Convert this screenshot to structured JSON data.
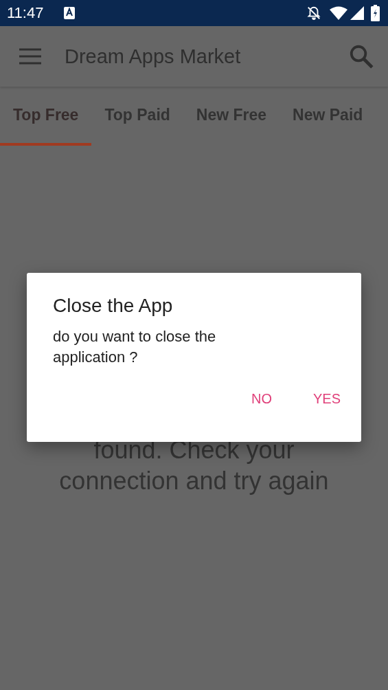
{
  "status_bar": {
    "time": "11:47"
  },
  "app_bar": {
    "title": "Dream Apps Market"
  },
  "tabs": [
    {
      "label": "Top Free",
      "selected": true
    },
    {
      "label": "Top Paid",
      "selected": false
    },
    {
      "label": "New Free",
      "selected": false
    },
    {
      "label": "New Paid",
      "selected": false
    }
  ],
  "message": {
    "lines": [
      "found. Check your",
      "connection and try again"
    ]
  },
  "dialog": {
    "title": "Close the App",
    "message": "do you want to close the application ?",
    "buttons": [
      "NO",
      "YES"
    ]
  }
}
